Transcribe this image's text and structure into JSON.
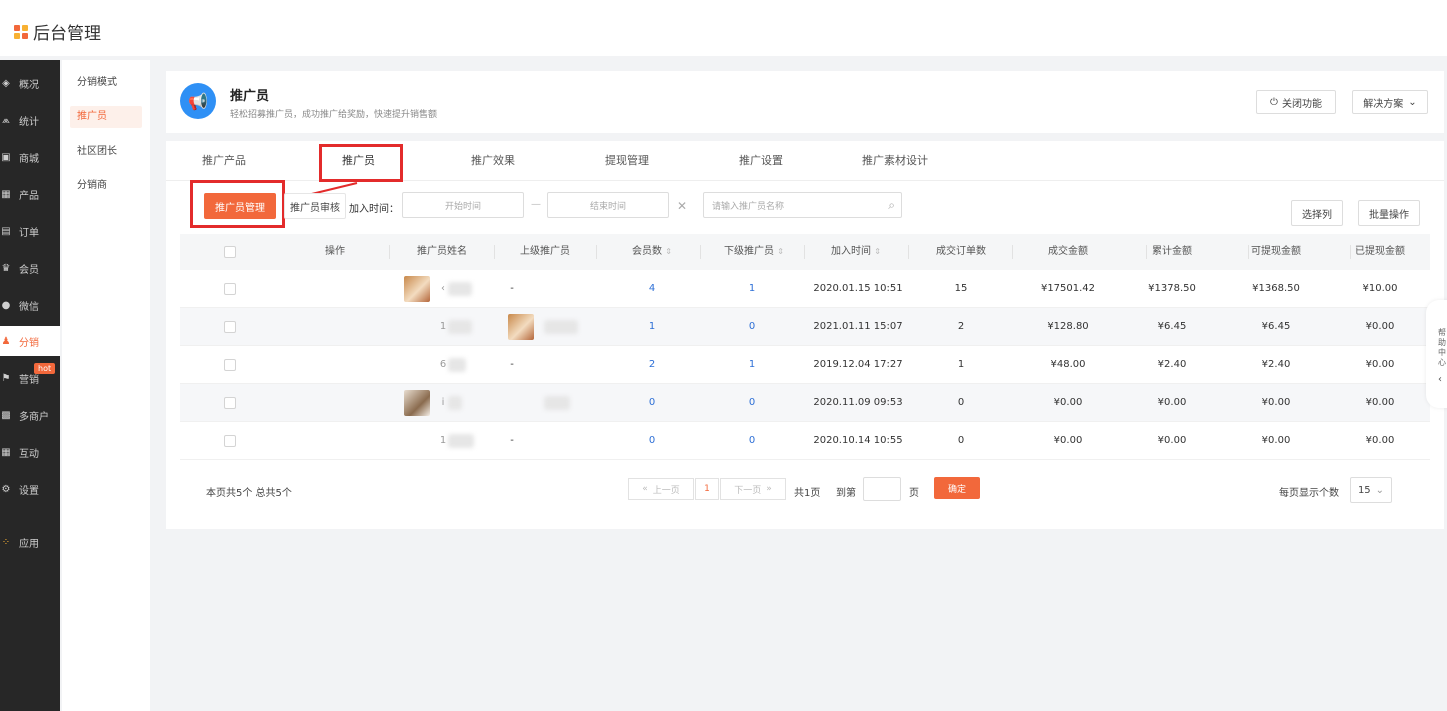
{
  "app": {
    "title": "后台管理",
    "logo_colors": [
      "#f2683b",
      "#f8b133",
      "#f8b133",
      "#f2683b"
    ]
  },
  "sidebar": {
    "items": [
      {
        "label": "概况",
        "icon": "layers-icon",
        "glyph": "◈"
      },
      {
        "label": "统计",
        "icon": "chart-icon",
        "glyph": "⩕"
      },
      {
        "label": "商城",
        "icon": "store-icon",
        "glyph": "▣"
      },
      {
        "label": "产品",
        "icon": "grid-icon",
        "glyph": "▦"
      },
      {
        "label": "订单",
        "icon": "order-icon",
        "glyph": "▤"
      },
      {
        "label": "会员",
        "icon": "crown-icon",
        "glyph": "♛"
      },
      {
        "label": "微信",
        "icon": "wechat-icon",
        "glyph": "●"
      },
      {
        "label": "分销",
        "icon": "users-icon",
        "glyph": "♟"
      },
      {
        "label": "营销",
        "icon": "flag-icon",
        "glyph": "⚑",
        "badge": "hot"
      },
      {
        "label": "多商户",
        "icon": "merchant-icon",
        "glyph": "▩"
      },
      {
        "label": "互动",
        "icon": "interact-icon",
        "glyph": "▦"
      },
      {
        "label": "设置",
        "icon": "gear-icon",
        "glyph": "⚙"
      },
      {
        "label": "应用",
        "icon": "apps-icon",
        "glyph": "⁘"
      }
    ]
  },
  "subnav": {
    "items": [
      "分销模式",
      "推广员",
      "社区团长",
      "分销商"
    ]
  },
  "header": {
    "title": "推广员",
    "subtitle": "轻松招募推广员，成功推广给奖励，快速提升销售额",
    "close_btn": "关闭功能",
    "solution_btn": "解决方案"
  },
  "tabs": [
    "推广产品",
    "推广员",
    "推广效果",
    "提现管理",
    "推广设置",
    "推广素材设计"
  ],
  "filters": {
    "manage_btn": "推广员管理",
    "review_btn": "推广员审核",
    "join_time_label": "加入时间：",
    "start_placeholder": "开始时间",
    "end_placeholder": "结束时间",
    "search_placeholder": "请输入推广员名称",
    "choose_cols_btn": "选择列",
    "batch_btn": "批量操作"
  },
  "table": {
    "headers": [
      "操作",
      "推广员姓名",
      "上级推广员",
      "会员数",
      "下级推广员",
      "加入时间",
      "成交订单数",
      "成交金额",
      "累计金额",
      "可提现金额",
      "已提现金额"
    ],
    "rows": [
      {
        "name": "‹",
        "parent": "-",
        "members": "4",
        "subs": "1",
        "time": "2020.01.15 10:51",
        "orders": "15",
        "deal": "¥17501.42",
        "total": "¥1378.50",
        "withdrawable": "¥1368.50",
        "withdrawn": "¥10.00"
      },
      {
        "name": "1",
        "parent": "",
        "members": "1",
        "subs": "0",
        "time": "2021.01.11 15:07",
        "orders": "2",
        "deal": "¥128.80",
        "total": "¥6.45",
        "withdrawable": "¥6.45",
        "withdrawn": "¥0.00"
      },
      {
        "name": "6",
        "parent": "-",
        "members": "2",
        "subs": "1",
        "time": "2019.12.04 17:27",
        "orders": "1",
        "deal": "¥48.00",
        "total": "¥2.40",
        "withdrawable": "¥2.40",
        "withdrawn": "¥0.00"
      },
      {
        "name": "i",
        "parent": "",
        "members": "0",
        "subs": "0",
        "time": "2020.11.09 09:53",
        "orders": "0",
        "deal": "¥0.00",
        "total": "¥0.00",
        "withdrawable": "¥0.00",
        "withdrawn": "¥0.00"
      },
      {
        "name": "1",
        "parent": "-",
        "members": "0",
        "subs": "0",
        "time": "2020.10.14 10:55",
        "orders": "0",
        "deal": "¥0.00",
        "total": "¥0.00",
        "withdrawable": "¥0.00",
        "withdrawn": "¥0.00"
      }
    ]
  },
  "footer": {
    "count_text": "本页共5个  总共5个",
    "prev": "上一页",
    "current_page": "1",
    "next": "下一页",
    "total_pages": "共1页",
    "goto_label": "到第",
    "page_unit": "页",
    "confirm": "确定",
    "per_page_label": "每页显示个数",
    "per_page_value": "15"
  },
  "help": {
    "text": "帮助中心"
  },
  "colors": {
    "accent": "#f2683b",
    "link": "#2d6fd6",
    "highlight_box": "#e32b2b",
    "sidebar_bg": "#272727"
  }
}
